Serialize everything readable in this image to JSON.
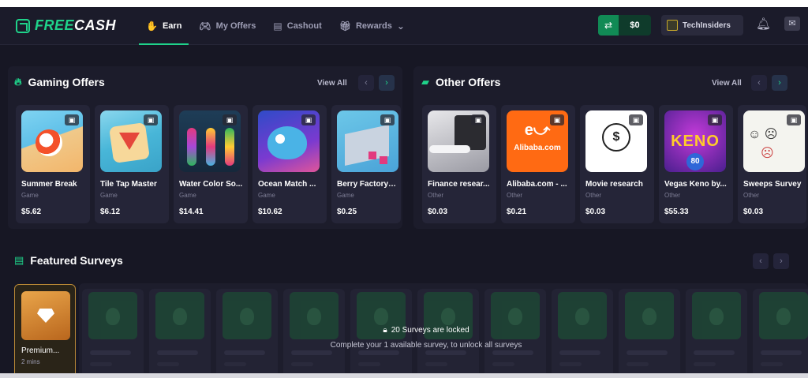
{
  "nav": {
    "logo_prefix": "FREE",
    "logo_suffix": "CASH",
    "items": [
      {
        "label": "Earn",
        "icon": "earn-icon",
        "active": true
      },
      {
        "label": "My Offers",
        "icon": "gamepad-icon",
        "active": false
      },
      {
        "label": "Cashout",
        "icon": "store-icon",
        "active": false
      },
      {
        "label": "Rewards",
        "icon": "gift-icon",
        "active": false
      }
    ],
    "rewards_chevron": "⌄",
    "balance": "$0",
    "username": "TechInsiders"
  },
  "gaming": {
    "title": "Gaming Offers",
    "view_all": "View All",
    "offers": [
      {
        "title": "Summer Break",
        "category": "Game",
        "price": "$5.62"
      },
      {
        "title": "Tile Tap Master",
        "category": "Game",
        "price": "$6.12"
      },
      {
        "title": "Water Color So...",
        "category": "Game",
        "price": "$14.41"
      },
      {
        "title": "Ocean Match ...",
        "category": "Game",
        "price": "$10.62"
      },
      {
        "title": "Berry Factory T...",
        "category": "Game",
        "price": "$0.25"
      }
    ]
  },
  "other": {
    "title": "Other Offers",
    "view_all": "View All",
    "offers": [
      {
        "title": "Finance resear...",
        "category": "Other",
        "price": "$0.03"
      },
      {
        "title": "Alibaba.com - ...",
        "category": "Other",
        "price": "$0.21",
        "logo_text": "Alibaba.com"
      },
      {
        "title": "Movie research",
        "category": "Other",
        "price": "$0.03"
      },
      {
        "title": "Vegas Keno by...",
        "category": "Other",
        "price": "$55.33",
        "logo_text": "KENO",
        "logo_number": "80"
      },
      {
        "title": "Sweeps Survey",
        "category": "Other",
        "price": "$0.03"
      }
    ]
  },
  "surveys": {
    "title": "Featured Surveys",
    "premium_title": "Premium...",
    "premium_duration": "2 mins",
    "locked_title": "20 Surveys are locked",
    "locked_subtitle": "Complete your 1 available survey, to unlock all surveys"
  },
  "colors": {
    "accent": "#1fd28a",
    "background": "#171724",
    "card": "#252538"
  }
}
